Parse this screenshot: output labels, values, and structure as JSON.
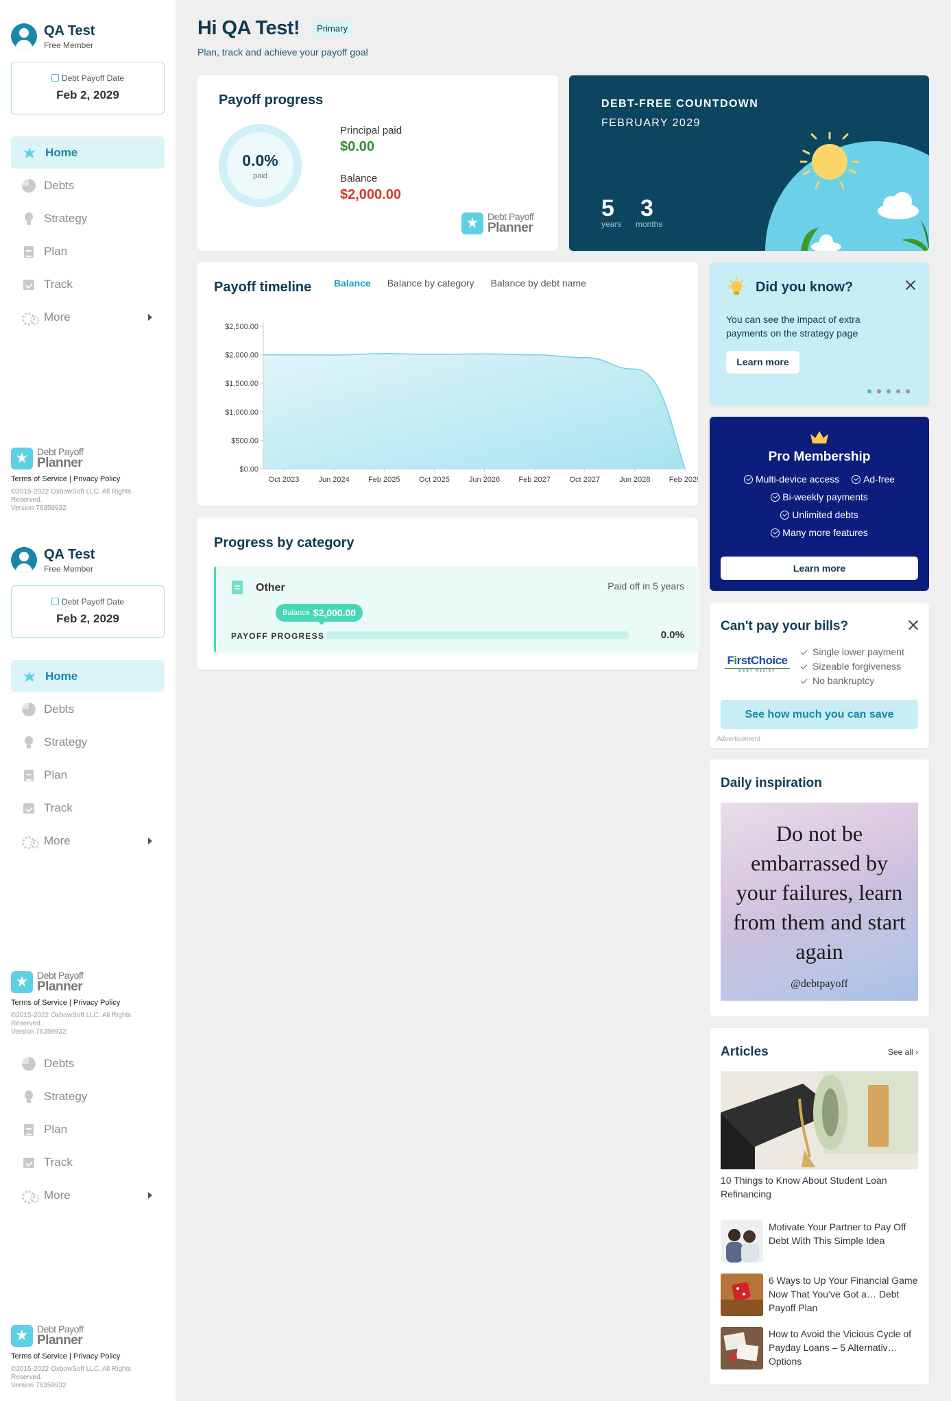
{
  "user": {
    "name": "QA Test",
    "role": "Free Member"
  },
  "payoff_date": {
    "label": "Debt Payoff Date",
    "value": "Feb 2, 2029"
  },
  "nav": {
    "items": [
      {
        "label": "Home"
      },
      {
        "label": "Debts"
      },
      {
        "label": "Strategy"
      },
      {
        "label": "Plan"
      },
      {
        "label": "Track"
      },
      {
        "label": "More"
      }
    ]
  },
  "logo": {
    "top": "Debt Payoff",
    "bottom": "Planner"
  },
  "footer": {
    "terms": "Terms of Service",
    "sep": "|",
    "privacy": "Privacy Policy",
    "copyright": "©2015-2022 OxbowSoft LLC. All Rights Reserved.",
    "version": "Version 76359932"
  },
  "header": {
    "greeting": "Hi QA Test!",
    "badge": "Primary",
    "subtitle": "Plan, track and achieve your payoff goal"
  },
  "payoff_progress": {
    "title": "Payoff progress",
    "percent": "0.0%",
    "paid_label": "paid",
    "principal_label": "Principal paid",
    "principal_value": "$0.00",
    "balance_label": "Balance",
    "balance_value": "$2,000.00"
  },
  "countdown": {
    "title": "DEBT-FREE COUNTDOWN",
    "subtitle": "FEBRUARY 2029",
    "years": "5",
    "years_label": "years",
    "months": "3",
    "months_label": "months"
  },
  "timeline": {
    "title": "Payoff timeline",
    "tabs": [
      "Balance",
      "Balance by category",
      "Balance by debt name"
    ]
  },
  "chart_data": {
    "type": "area",
    "title": "",
    "xlabel": "",
    "ylabel": "",
    "x": [
      "Oct 2023",
      "Jun 2024",
      "Feb 2025",
      "Oct 2025",
      "Jun 2026",
      "Feb 2027",
      "Oct 2027",
      "Jun 2028",
      "Feb 2029"
    ],
    "y_ticks": [
      "$0.00",
      "$500.00",
      "$1,000.00",
      "$1,500.00",
      "$2,000.00",
      "$2,500.00"
    ],
    "ylim": [
      0,
      2500
    ],
    "series": [
      {
        "values": [
          2000,
          1995,
          2020,
          2005,
          2015,
          1998,
          1950,
          1750,
          0
        ]
      }
    ],
    "grid": false,
    "color": "#a7e3ef"
  },
  "category": {
    "title": "Progress by category",
    "name": "Other",
    "paid_off": "Paid off in 5 years",
    "balance_label": "Balance",
    "balance_value": "$2,000.00",
    "progress_label": "PAYOFF PROGRESS",
    "progress_pct": "0.0%",
    "progress_fraction": 0.0
  },
  "did_you_know": {
    "title": "Did you know?",
    "text": "You can see the impact of extra payments on the strategy page",
    "button": "Learn more"
  },
  "pro": {
    "title": "Pro Membership",
    "features": [
      "Multi-device access",
      "Ad-free",
      "Bi-weekly payments",
      "Unlimited debts",
      "Many more features"
    ],
    "button": "Learn more"
  },
  "ad": {
    "title": "Can't pay your bills?",
    "brand_first": "F",
    "brand_i": "i",
    "brand_rest": "rstChoice",
    "brand_sub": "DEBT RELIEF",
    "points": [
      "Single lower payment",
      "Sizeable forgiveness",
      "No bankruptcy"
    ],
    "button": "See how much you can save",
    "label": "Advertisement"
  },
  "inspiration": {
    "title": "Daily inspiration",
    "quote": "Do not be embarrassed by your failures, learn from them and start again",
    "handle": "@debtpayoff"
  },
  "articles": {
    "title": "Articles",
    "see_all": "See all",
    "items": [
      "10 Things to Know About Student Loan Refinancing",
      "Motivate Your Partner to Pay Off Debt With This Simple Idea",
      "6 Ways to Up Your Financial Game Now That You’ve Got a… Debt Payoff Plan",
      "How to Avoid the Vicious Cycle of Payday Loans – 5 Alternativ… Options"
    ]
  },
  "colors": {
    "teal": "#1a87a6",
    "navy": "#0b4560",
    "pro": "#0c1e7d",
    "green": "#2f8d2a",
    "red": "#d13a2a",
    "accent": "#47d6b6"
  }
}
